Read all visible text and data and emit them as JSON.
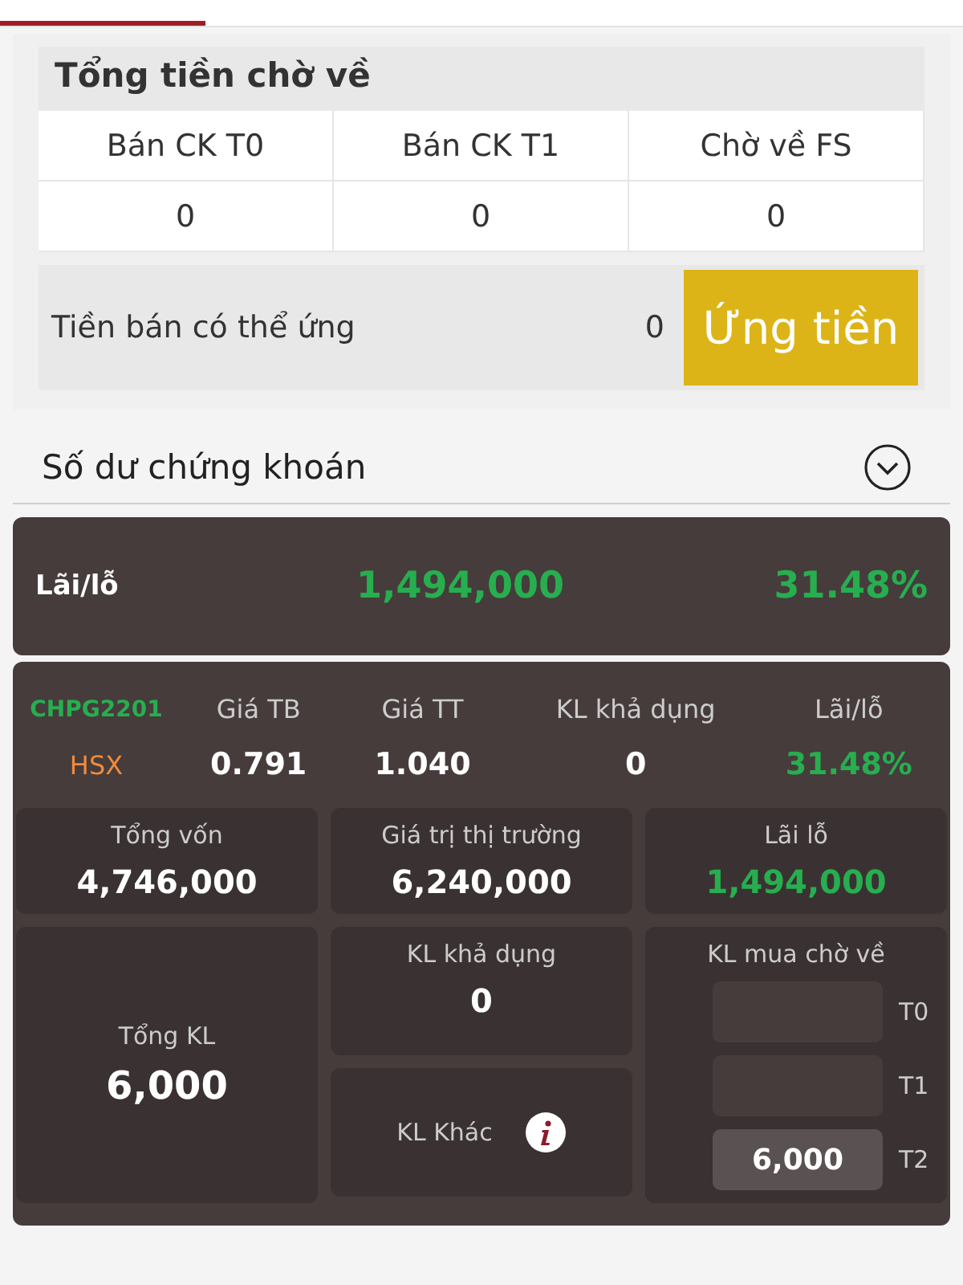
{
  "tabs": [
    {
      "selected": true
    }
  ],
  "pending_cash": {
    "title": "Tổng tiền chờ về",
    "columns": [
      "Bán CK T0",
      "Bán CK T1",
      "Chờ về FS"
    ],
    "values": [
      "0",
      "0",
      "0"
    ],
    "advance_label": "Tiền bán có thể ứng",
    "advance_value": "0",
    "advance_button": "Ứng tiền"
  },
  "holdings": {
    "title": "Số dư chứng khoán",
    "summary": {
      "label": "Lãi/lỗ",
      "amount": "1,494,000",
      "percent": "31.48%",
      "color": "#27ae4f"
    },
    "stock": {
      "symbol": "CHPG2201",
      "exchange": "HSX",
      "columns": [
        {
          "label": "Giá TB",
          "value": "0.791",
          "color": "#ffffff"
        },
        {
          "label": "Giá TT",
          "value": "1.040",
          "color": "#ffffff"
        },
        {
          "label": "KL khả dụng",
          "value": "0",
          "color": "#ffffff"
        },
        {
          "label": "Lãi/lỗ",
          "value": "31.48%",
          "color": "#27ae4f"
        }
      ],
      "totals": [
        {
          "label": "Tổng vốn",
          "value": "4,746,000",
          "color": "#ffffff"
        },
        {
          "label": "Giá trị thị trường",
          "value": "6,240,000",
          "color": "#ffffff"
        },
        {
          "label": "Lãi lỗ",
          "value": "1,494,000",
          "color": "#27ae4f"
        }
      ],
      "total_volume": {
        "label": "Tổng KL",
        "value": "6,000"
      },
      "available_volume": {
        "label": "KL khả dụng",
        "value": "0"
      },
      "other_volume": {
        "label": "KL Khác"
      },
      "pending_buy": {
        "label": "KL mua chờ về",
        "rows": [
          {
            "label": "T0"
          },
          {
            "label": "T1"
          },
          {
            "label": "T2",
            "value": "6,000"
          }
        ]
      }
    }
  }
}
